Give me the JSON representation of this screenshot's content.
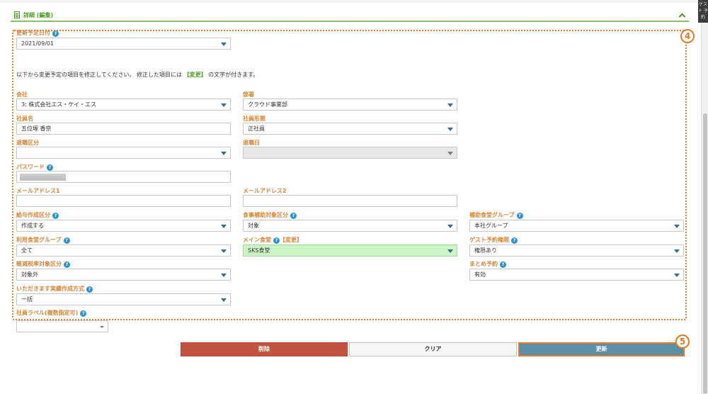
{
  "section": {
    "title": "詳細 (編集)"
  },
  "badges": {
    "b4": "4",
    "b5": "5"
  },
  "update_date": {
    "label": "更新予定日付",
    "value": "2021/09/01"
  },
  "notice": {
    "prefix": "以下から変更予定の項目を修正してください。 修正した項目には ",
    "changed": "【変更】",
    "suffix": " の文字が付きます。"
  },
  "fields": {
    "company": {
      "label": "会社",
      "value": "3: 株式会社エス・ケイ・エス"
    },
    "department": {
      "label": "部署",
      "value": "クラウド事業部"
    },
    "employee_name": {
      "label": "社員名",
      "value": "五位塚 香奈"
    },
    "employment_type": {
      "label": "社員形態",
      "value": "正社員"
    },
    "retirement_type": {
      "label": "退職区分",
      "value": ""
    },
    "retirement_date": {
      "label": "退職日",
      "value": ""
    },
    "password": {
      "label": "パスワード"
    },
    "email1": {
      "label": "メールアドレス1",
      "value": ""
    },
    "email2": {
      "label": "メールアドレス2",
      "value": ""
    },
    "salary_creation": {
      "label": "給与作成区分",
      "value": "作成する"
    },
    "meal_subsidy": {
      "label": "食事補助対象区分",
      "value": "対象"
    },
    "subsidy_group": {
      "label": "補助食堂グループ",
      "value": "本社グループ"
    },
    "cafeteria_group": {
      "label": "利用食堂グループ",
      "value": "全て"
    },
    "main_cafeteria": {
      "label": "メイン食堂",
      "change_tag": "【変更】",
      "value": "SKS食堂"
    },
    "guest_reservation": {
      "label": "ゲスト予約権限",
      "value": "権限あり"
    },
    "reduced_tax": {
      "label": "軽減税率対象区分",
      "value": "対象外"
    },
    "bulk_reservation": {
      "label": "まとめ予約",
      "value": "有効"
    },
    "itadakimasu": {
      "label": "いただきます実績作成方式",
      "value": "一括"
    },
    "employee_label": {
      "label": "社員ラベル(複数指定可)",
      "value": ""
    }
  },
  "buttons": {
    "delete": "削除",
    "clear": "クリア",
    "update": "更新"
  },
  "corner_text": "ゲスト 予約",
  "icons": [
    "document-icon",
    "chevron-up-icon",
    "help-icon",
    "dropdown-arrow-icon"
  ]
}
